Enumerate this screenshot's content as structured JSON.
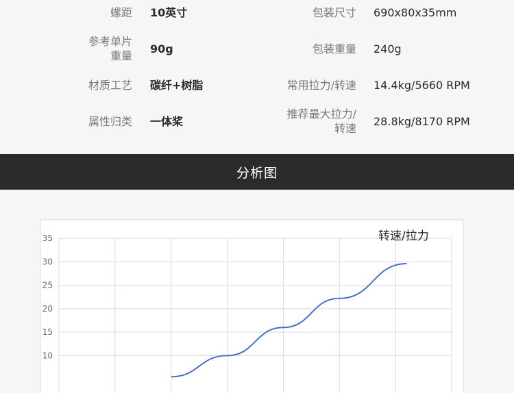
{
  "specs": {
    "left": [
      {
        "label_lines": [
          "螺距"
        ],
        "value": "10英寸"
      },
      {
        "label_lines": [
          "参考单片",
          "重量"
        ],
        "value": "90g"
      },
      {
        "label_lines": [
          "材质工艺"
        ],
        "value": "碳纤+树脂"
      },
      {
        "label_lines": [
          "属性归类"
        ],
        "value": "一体桨"
      }
    ],
    "right": [
      {
        "label_lines": [
          "包装尺寸"
        ],
        "value": "690x80x35mm"
      },
      {
        "label_lines": [
          "包装重量"
        ],
        "value": "240g"
      },
      {
        "label_lines": [
          "常用拉力/转速"
        ],
        "value": "14.4kg/5660 RPM"
      },
      {
        "label_lines": [
          "推荐最大拉力/",
          "转速"
        ],
        "value": "28.8kg/8170 RPM"
      }
    ]
  },
  "banner": {
    "title": "分析图"
  },
  "chart_data": {
    "type": "line",
    "title": "转速/拉力",
    "xlabel": "",
    "ylabel": "",
    "ylim": [
      0,
      35
    ],
    "y_ticks": [
      10,
      15,
      20,
      25,
      30,
      35
    ],
    "xlim": [
      0,
      7
    ],
    "grid": true,
    "series": [
      {
        "x": [
          2.0,
          3.0,
          4.0,
          5.0,
          6.2
        ],
        "y": [
          5.5,
          10.0,
          16.0,
          22.2,
          29.6
        ]
      }
    ],
    "colors": {
      "line": "#4472c4",
      "grid": "#d9d9d9",
      "axis_text": "#666666"
    }
  }
}
